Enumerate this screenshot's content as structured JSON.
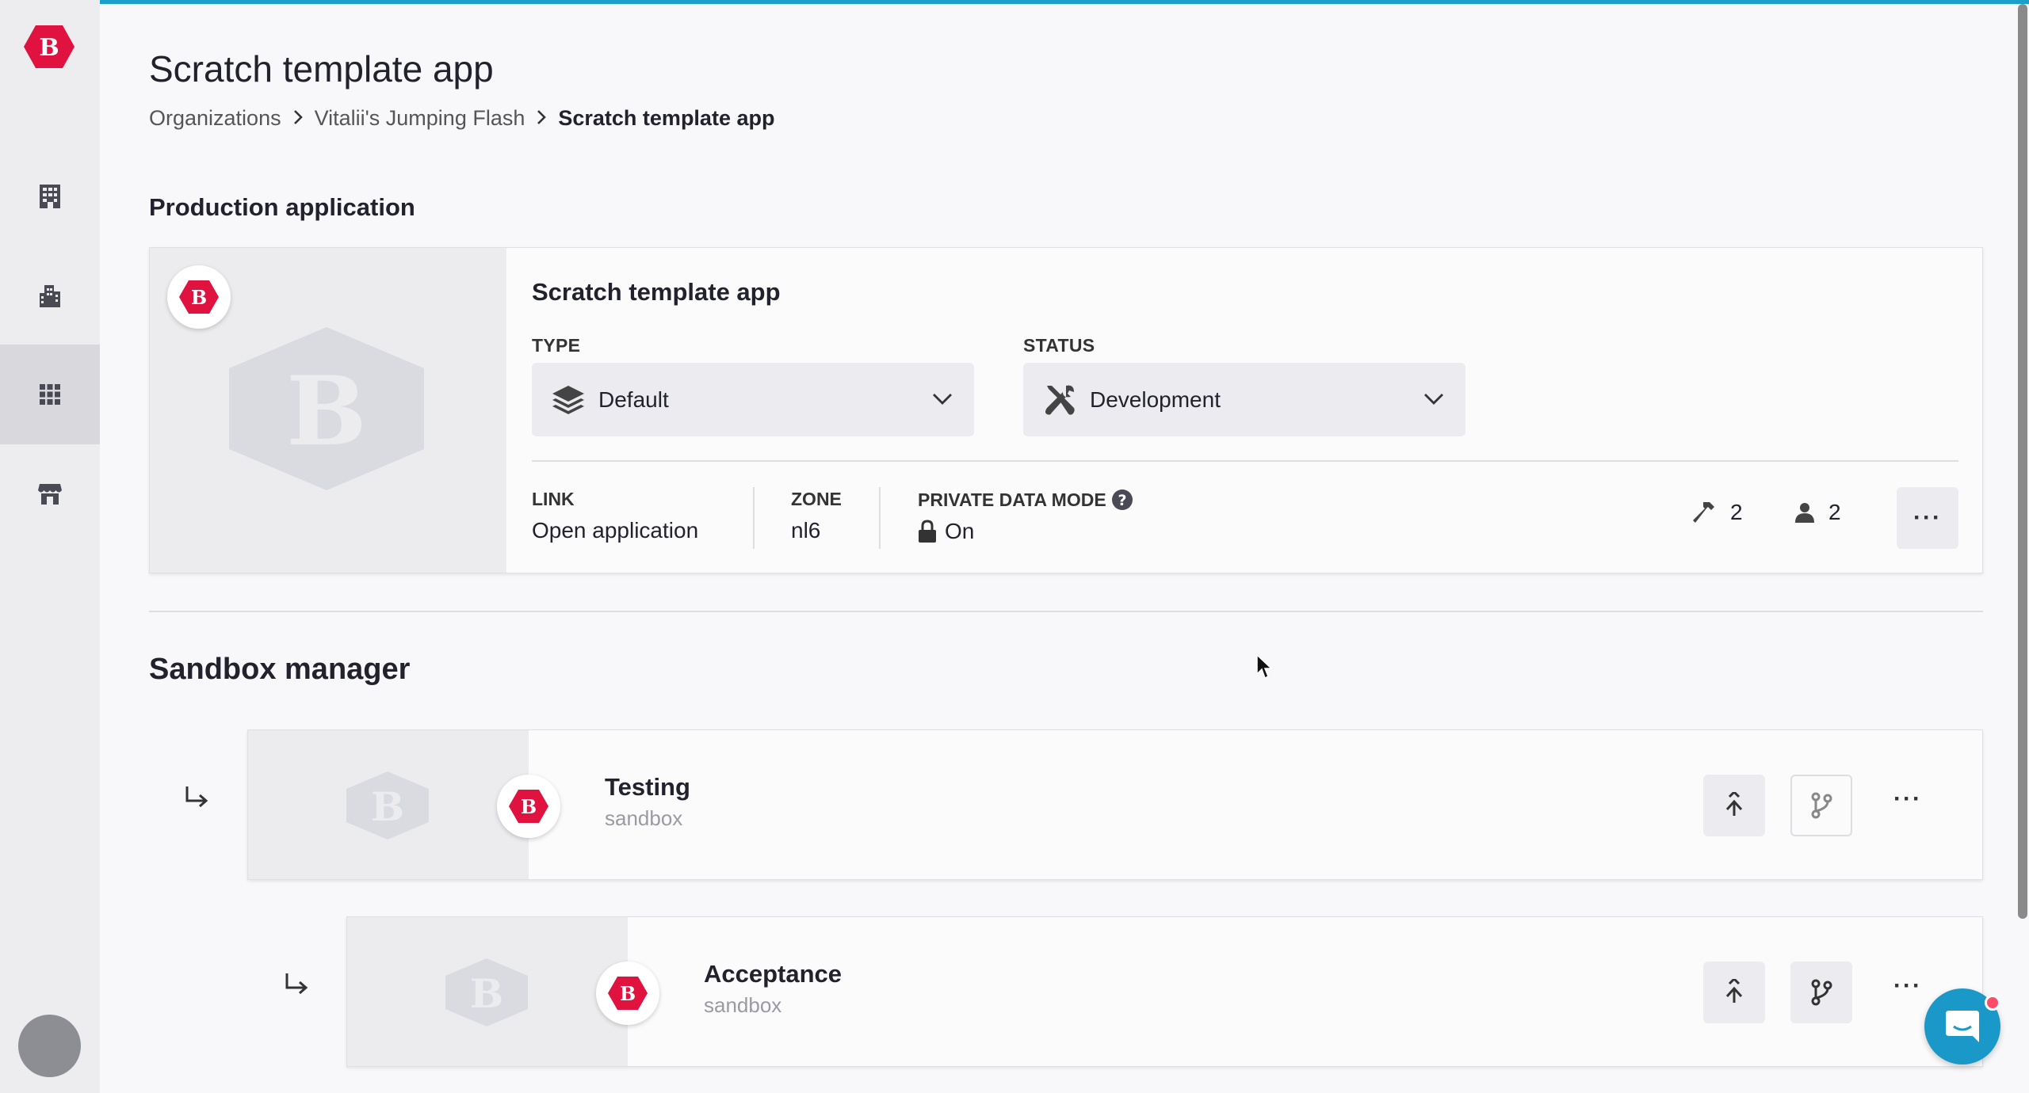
{
  "sidebar": {
    "logo_letter": "B",
    "items": [
      {
        "name": "organizations",
        "icon": "building-icon"
      },
      {
        "name": "city",
        "icon": "city-icon"
      },
      {
        "name": "apps",
        "icon": "grid-icon",
        "active": true
      },
      {
        "name": "store",
        "icon": "store-icon"
      }
    ]
  },
  "header": {
    "title": "Scratch template app",
    "breadcrumb": [
      "Organizations",
      "Vitalii's Jumping Flash",
      "Scratch template app"
    ]
  },
  "production": {
    "section_title": "Production application",
    "app_name": "Scratch template app",
    "type_label": "TYPE",
    "type_value": "Default",
    "status_label": "STATUS",
    "status_value": "Development",
    "link_label": "LINK",
    "link_value": "Open application",
    "zone_label": "ZONE",
    "zone_value": "nl6",
    "private_label": "PRIVATE DATA MODE",
    "private_value": "On",
    "builds_count": "2",
    "users_count": "2",
    "more_label": "···"
  },
  "sandbox": {
    "section_title": "Sandbox manager",
    "items": [
      {
        "name": "Testing",
        "subtitle": "sandbox"
      },
      {
        "name": "Acceptance",
        "subtitle": "sandbox"
      }
    ],
    "more_label": "···"
  },
  "colors": {
    "brand": "#e0123f",
    "accent": "#1aa0c8"
  }
}
